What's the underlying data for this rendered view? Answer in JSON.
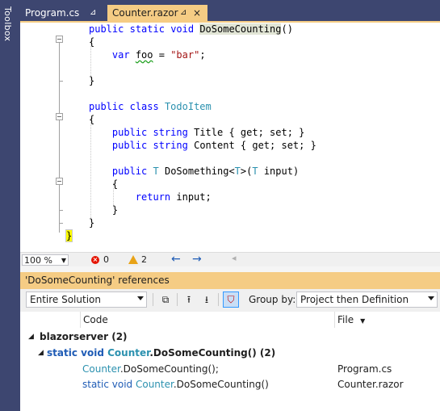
{
  "toolbox": {
    "label": "Toolbox"
  },
  "tabs": [
    {
      "label": "Program.cs",
      "pin": "⊿",
      "active": false
    },
    {
      "label": "Counter.razor",
      "pin": "⊿",
      "close": "×",
      "active": true
    }
  ],
  "code": {
    "line1": {
      "kw1": "public",
      "kw2": "static",
      "kw3": "void",
      "name": "DoSomeCounting",
      "rest": "()"
    },
    "line2": "{",
    "line3": {
      "kw": "var",
      "ident": "foo",
      "op": " = ",
      "str": "\"bar\"",
      "end": ";"
    },
    "line4": "}",
    "line5": {
      "kw1": "public",
      "kw2": "class",
      "type": "TodoItem"
    },
    "line6": "{",
    "line7": {
      "kw1": "public",
      "kw2": "string",
      "rest": "Title { get; set; }"
    },
    "line8": {
      "kw1": "public",
      "kw2": "string",
      "rest": "Content { get; set; }"
    },
    "line9": {
      "kw1": "public",
      "t1": "T",
      "m": "DoSomething<",
      "t2": "T",
      "m2": ">(",
      "t3": "T",
      "rest": " input)"
    },
    "line10": "{",
    "line11": {
      "kw": "return",
      "rest": " input;"
    },
    "line12": "}",
    "line13": "}",
    "line14": "}"
  },
  "statusbar": {
    "zoom": "100 %",
    "errors": "0",
    "warnings": "2",
    "back_icon": "arrow-left-icon",
    "forward_icon": "arrow-right-icon"
  },
  "references": {
    "title": "'DoSomeCounting' references",
    "scope": "Entire Solution",
    "group_by_label": "Group by:",
    "group_by_value": "Project then Definition",
    "columns": {
      "code": "Code",
      "file": "File"
    },
    "project": {
      "name": "blazorserver",
      "count": "(2)"
    },
    "definition": {
      "kw1": "static",
      "kw2": "void",
      "cls": "Counter",
      "member": ".DoSomeCounting()",
      "count": "(2)"
    },
    "rows": [
      {
        "cls": "Counter",
        "code": ".DoSomeCounting();",
        "prefix": "",
        "file": "Program.cs"
      },
      {
        "cls": "Counter",
        "code": ".DoSomeCounting()",
        "prefix": "static void ",
        "file": "Counter.razor"
      }
    ]
  },
  "colors": {
    "accent": "#f5cc84",
    "frame": "#3d4670",
    "keyword": "#0000ff",
    "type": "#2b91af",
    "string": "#a31515"
  }
}
